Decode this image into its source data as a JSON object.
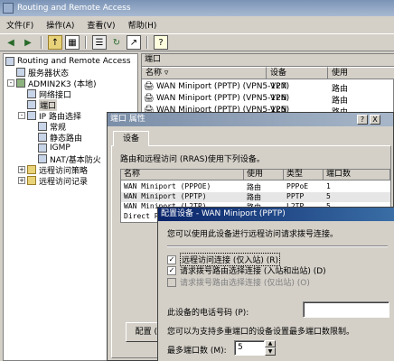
{
  "app": {
    "title": "Routing and Remote Access"
  },
  "menu": [
    "文件(F)",
    "操作(A)",
    "查看(V)",
    "帮助(H)"
  ],
  "toolbar": [
    "back-icon",
    "forward-icon",
    "up-icon",
    "show-hide-tree-icon",
    "properties-icon",
    "refresh-icon",
    "export-icon",
    "help-icon"
  ],
  "tree": {
    "root": "Routing and Remote Access",
    "server_status": "服务器状态",
    "server": "ADMIN2K3 (本地)",
    "network_interfaces": "网络接口",
    "ports": "端口",
    "ip_routing": "IP 路由选择",
    "general": "常规",
    "static_routes": "静态路由",
    "igmp": "IGMP",
    "nat": "NAT/基本防火",
    "remote_access_policies": "远程访问策略",
    "remote_access_logging": "远程访问记录"
  },
  "ports_pane": {
    "header": "端口",
    "columns": [
      "名称",
      "设备",
      "使用"
    ],
    "rows": [
      {
        "name": "WAN Miniport (PPTP) (VPN5-127)",
        "device": "VPN",
        "use": "路由"
      },
      {
        "name": "WAN Miniport (PPTP) (VPN5-126)",
        "device": "VPN",
        "use": "路由"
      },
      {
        "name": "WAN Miniport (PPTP) (VPN5-125)",
        "device": "VPN",
        "use": "路由"
      }
    ]
  },
  "ports_dialog": {
    "title": "端口 属性",
    "help_btn": "?",
    "close_btn": "X",
    "tab": "设备",
    "description": "路由和远程访问 (RRAS)使用下列设备。",
    "columns": [
      "名称",
      "使用",
      "类型",
      "端口数"
    ],
    "rows": [
      {
        "name": "WAN Miniport (PPPOE)",
        "use": "路由",
        "type": "PPPoE",
        "ports": "1"
      },
      {
        "name": "WAN Miniport (PPTP)",
        "use": "路由",
        "type": "PPTP",
        "ports": "5"
      },
      {
        "name": "WAN Miniport (L2TP)",
        "use": "路由",
        "type": "L2TP",
        "ports": "5"
      },
      {
        "name": "Direct P",
        "use": "",
        "type": "",
        "ports": ""
      }
    ],
    "configure_btn": "配置 (C"
  },
  "config_dialog": {
    "title": "配置设备 - WAN Miniport (PPTP)",
    "intro": "您可以使用此设备进行远程访问请求拨号连接。",
    "options": [
      {
        "label": "远程访问连接 (仅入站) (R)",
        "checked": true,
        "disabled": false
      },
      {
        "label": "请求拨号路由选择连接 (入站和出站) (D)",
        "checked": true,
        "disabled": false
      },
      {
        "label": "请求拨号路由选择连接 (仅出站) (O)",
        "checked": false,
        "disabled": true
      }
    ],
    "phone_label": "此设备的电话号码 (P):",
    "phone_value": "",
    "limit_note": "您可以为支持多重端口的设备设置最多端口数限制。",
    "max_ports_label": "最多端口数 (M):",
    "max_ports_value": "5"
  }
}
